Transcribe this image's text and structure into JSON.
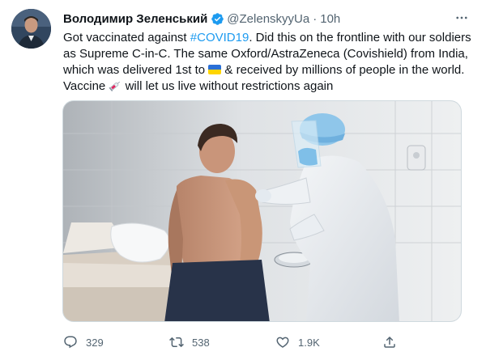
{
  "tweet": {
    "author": {
      "display_name": "Володимир Зеленський",
      "handle": "@ZelenskyyUa",
      "verified": true,
      "avatar": "author-avatar"
    },
    "separator": "·",
    "time": "10h",
    "more_icon": "more-options-icon",
    "text": {
      "line1_pre": "Got vaccinated against ",
      "hashtag": "#COVID19",
      "line1_post": ". Did this on the frontline with our soldiers",
      "line2": "as Supreme C-in-C. The same Oxford/AstraZeneca (Covishield) from India,",
      "line3_pre": "which was delivered 1st to ",
      "line3_flag": "ukraine-flag-emoji",
      "line3_post": " & received by millions of people in the world.",
      "line4_pre": "Vaccine ",
      "line4_emoji": "syringe-emoji",
      "line4_post": " will let us live without restrictions again"
    },
    "media": {
      "type": "photo",
      "subject": "vaccination-photo"
    },
    "actions": {
      "reply": {
        "icon": "reply-icon",
        "count": "329"
      },
      "retweet": {
        "icon": "retweet-icon",
        "count": "538"
      },
      "like": {
        "icon": "like-icon",
        "count": "1.9K"
      },
      "share": {
        "icon": "share-icon"
      }
    },
    "colors": {
      "text": "#0f1419",
      "muted": "#536471",
      "link": "#1d9bf0",
      "verified": "#1d9bf0",
      "border": "#cfd9de"
    }
  }
}
